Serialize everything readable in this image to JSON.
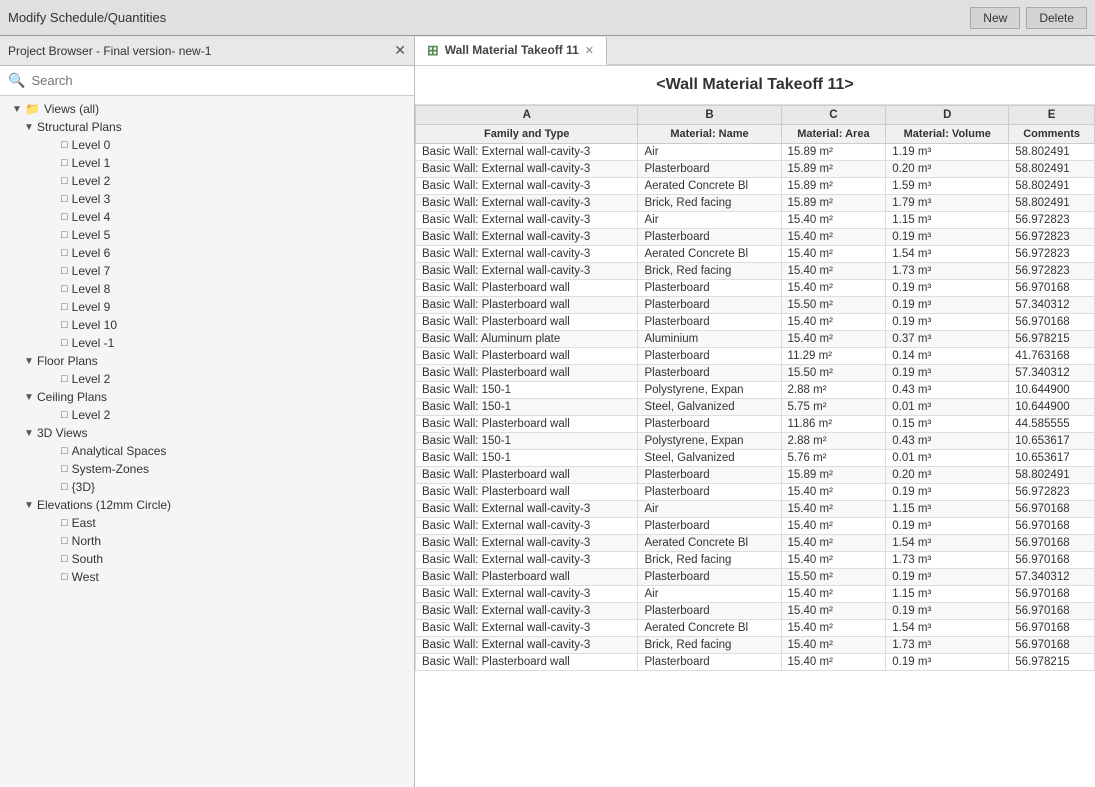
{
  "toolbar": {
    "title": "Modify Schedule/Quantities",
    "new_label": "New",
    "delete_label": "Delete"
  },
  "left_panel": {
    "header": "Project Browser - Final version- new-1",
    "search_placeholder": "Search",
    "tree": [
      {
        "id": "views-all",
        "label": "Views (all)",
        "indent": 1,
        "type": "group",
        "arrow": "▼",
        "icon": "📁"
      },
      {
        "id": "structural-plans",
        "label": "Structural Plans",
        "indent": 2,
        "type": "group",
        "arrow": "▼",
        "icon": ""
      },
      {
        "id": "level-0",
        "label": "Level 0",
        "indent": 4,
        "type": "view",
        "arrow": "",
        "icon": "□"
      },
      {
        "id": "level-1",
        "label": "Level 1",
        "indent": 4,
        "type": "view",
        "arrow": "",
        "icon": "□"
      },
      {
        "id": "level-2",
        "label": "Level 2",
        "indent": 4,
        "type": "view",
        "arrow": "",
        "icon": "□"
      },
      {
        "id": "level-3",
        "label": "Level 3",
        "indent": 4,
        "type": "view",
        "arrow": "",
        "icon": "□"
      },
      {
        "id": "level-4",
        "label": "Level 4",
        "indent": 4,
        "type": "view",
        "arrow": "",
        "icon": "□"
      },
      {
        "id": "level-5",
        "label": "Level 5",
        "indent": 4,
        "type": "view",
        "arrow": "",
        "icon": "□"
      },
      {
        "id": "level-6",
        "label": "Level 6",
        "indent": 4,
        "type": "view",
        "arrow": "",
        "icon": "□"
      },
      {
        "id": "level-7",
        "label": "Level 7",
        "indent": 4,
        "type": "view",
        "arrow": "",
        "icon": "□"
      },
      {
        "id": "level-8",
        "label": "Level 8",
        "indent": 4,
        "type": "view",
        "arrow": "",
        "icon": "□"
      },
      {
        "id": "level-9",
        "label": "Level 9",
        "indent": 4,
        "type": "view",
        "arrow": "",
        "icon": "□"
      },
      {
        "id": "level-10",
        "label": "Level 10",
        "indent": 4,
        "type": "view",
        "arrow": "",
        "icon": "□"
      },
      {
        "id": "level-neg1",
        "label": "Level -1",
        "indent": 4,
        "type": "view",
        "arrow": "",
        "icon": "□"
      },
      {
        "id": "floor-plans",
        "label": "Floor Plans",
        "indent": 2,
        "type": "group",
        "arrow": "▼",
        "icon": ""
      },
      {
        "id": "floor-level-2",
        "label": "Level 2",
        "indent": 4,
        "type": "view",
        "arrow": "",
        "icon": "□"
      },
      {
        "id": "ceiling-plans",
        "label": "Ceiling Plans",
        "indent": 2,
        "type": "group",
        "arrow": "▼",
        "icon": ""
      },
      {
        "id": "ceiling-level-2",
        "label": "Level 2",
        "indent": 4,
        "type": "view",
        "arrow": "",
        "icon": "□"
      },
      {
        "id": "3d-views",
        "label": "3D Views",
        "indent": 2,
        "type": "group",
        "arrow": "▼",
        "icon": ""
      },
      {
        "id": "analytical-spaces",
        "label": "Analytical Spaces",
        "indent": 4,
        "type": "view",
        "arrow": "",
        "icon": "□"
      },
      {
        "id": "system-zones",
        "label": "System-Zones",
        "indent": 4,
        "type": "view",
        "arrow": "",
        "icon": "□"
      },
      {
        "id": "3d",
        "label": "{3D}",
        "indent": 4,
        "type": "view",
        "arrow": "",
        "icon": "□"
      },
      {
        "id": "elevations",
        "label": "Elevations (12mm Circle)",
        "indent": 2,
        "type": "group",
        "arrow": "▼",
        "icon": ""
      },
      {
        "id": "east",
        "label": "East",
        "indent": 4,
        "type": "view",
        "arrow": "",
        "icon": "□"
      },
      {
        "id": "north",
        "label": "North",
        "indent": 4,
        "type": "view",
        "arrow": "",
        "icon": "□"
      },
      {
        "id": "south",
        "label": "South",
        "indent": 4,
        "type": "view",
        "arrow": "",
        "icon": "□"
      },
      {
        "id": "west",
        "label": "West",
        "indent": 4,
        "type": "view",
        "arrow": "",
        "icon": "□"
      }
    ]
  },
  "right_panel": {
    "tab_icon": "⊞",
    "tab_label": "Wall Material Takeoff 11",
    "schedule_title": "<Wall Material Takeoff 11>",
    "columns": {
      "letters": [
        "A",
        "B",
        "C",
        "D",
        "E"
      ],
      "headers": [
        "Family and Type",
        "Material: Name",
        "Material: Area",
        "Material: Volume",
        "Comments"
      ]
    },
    "rows": [
      [
        "Basic Wall: External wall-cavity-3",
        "Air",
        "15.89 m²",
        "1.19 m³",
        "58.802491"
      ],
      [
        "Basic Wall: External wall-cavity-3",
        "Plasterboard",
        "15.89 m²",
        "0.20 m³",
        "58.802491"
      ],
      [
        "Basic Wall: External wall-cavity-3",
        "Aerated Concrete Bl",
        "15.89 m²",
        "1.59 m³",
        "58.802491"
      ],
      [
        "Basic Wall: External wall-cavity-3",
        "Brick, Red facing",
        "15.89 m²",
        "1.79 m³",
        "58.802491"
      ],
      [
        "Basic Wall: External wall-cavity-3",
        "Air",
        "15.40 m²",
        "1.15 m³",
        "56.972823"
      ],
      [
        "Basic Wall: External wall-cavity-3",
        "Plasterboard",
        "15.40 m²",
        "0.19 m³",
        "56.972823"
      ],
      [
        "Basic Wall: External wall-cavity-3",
        "Aerated Concrete Bl",
        "15.40 m²",
        "1.54 m³",
        "56.972823"
      ],
      [
        "Basic Wall: External wall-cavity-3",
        "Brick, Red facing",
        "15.40 m²",
        "1.73 m³",
        "56.972823"
      ],
      [
        "Basic Wall: Plasterboard wall",
        "Plasterboard",
        "15.40 m²",
        "0.19 m³",
        "56.970168"
      ],
      [
        "Basic Wall: Plasterboard wall",
        "Plasterboard",
        "15.50 m²",
        "0.19 m³",
        "57.340312"
      ],
      [
        "Basic Wall: Plasterboard wall",
        "Plasterboard",
        "15.40 m²",
        "0.19 m³",
        "56.970168"
      ],
      [
        "Basic Wall: Aluminum plate",
        "Aluminium",
        "15.40 m²",
        "0.37 m³",
        "56.978215"
      ],
      [
        "Basic Wall: Plasterboard wall",
        "Plasterboard",
        "11.29 m²",
        "0.14 m³",
        "41.763168"
      ],
      [
        "Basic Wall: Plasterboard wall",
        "Plasterboard",
        "15.50 m²",
        "0.19 m³",
        "57.340312"
      ],
      [
        "Basic Wall: 150-1",
        "Polystyrene, Expan",
        "2.88 m²",
        "0.43 m³",
        "10.644900"
      ],
      [
        "Basic Wall: 150-1",
        "Steel, Galvanized",
        "5.75 m²",
        "0.01 m³",
        "10.644900"
      ],
      [
        "Basic Wall: Plasterboard wall",
        "Plasterboard",
        "11.86 m²",
        "0.15 m³",
        "44.585555"
      ],
      [
        "Basic Wall: 150-1",
        "Polystyrene, Expan",
        "2.88 m²",
        "0.43 m³",
        "10.653617"
      ],
      [
        "Basic Wall: 150-1",
        "Steel, Galvanized",
        "5.76 m²",
        "0.01 m³",
        "10.653617"
      ],
      [
        "Basic Wall: Plasterboard wall",
        "Plasterboard",
        "15.89 m²",
        "0.20 m³",
        "58.802491"
      ],
      [
        "Basic Wall: Plasterboard wall",
        "Plasterboard",
        "15.40 m²",
        "0.19 m³",
        "56.972823"
      ],
      [
        "Basic Wall: External wall-cavity-3",
        "Air",
        "15.40 m²",
        "1.15 m³",
        "56.970168"
      ],
      [
        "Basic Wall: External wall-cavity-3",
        "Plasterboard",
        "15.40 m²",
        "0.19 m³",
        "56.970168"
      ],
      [
        "Basic Wall: External wall-cavity-3",
        "Aerated Concrete Bl",
        "15.40 m²",
        "1.54 m³",
        "56.970168"
      ],
      [
        "Basic Wall: External wall-cavity-3",
        "Brick, Red facing",
        "15.40 m²",
        "1.73 m³",
        "56.970168"
      ],
      [
        "Basic Wall: Plasterboard wall",
        "Plasterboard",
        "15.50 m²",
        "0.19 m³",
        "57.340312"
      ],
      [
        "Basic Wall: External wall-cavity-3",
        "Air",
        "15.40 m²",
        "1.15 m³",
        "56.970168"
      ],
      [
        "Basic Wall: External wall-cavity-3",
        "Plasterboard",
        "15.40 m²",
        "0.19 m³",
        "56.970168"
      ],
      [
        "Basic Wall: External wall-cavity-3",
        "Aerated Concrete Bl",
        "15.40 m²",
        "1.54 m³",
        "56.970168"
      ],
      [
        "Basic Wall: External wall-cavity-3",
        "Brick, Red facing",
        "15.40 m²",
        "1.73 m³",
        "56.970168"
      ],
      [
        "Basic Wall: Plasterboard wall",
        "Plasterboard",
        "15.40 m²",
        "0.19 m³",
        "56.978215"
      ]
    ]
  }
}
